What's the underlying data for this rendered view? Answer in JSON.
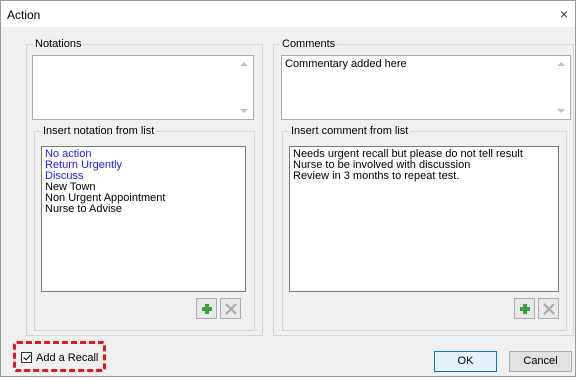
{
  "window": {
    "title": "Action",
    "close_glyph": "×"
  },
  "notations": {
    "group_label": "Notations",
    "value": "",
    "list_label": "Insert notation from list",
    "items": [
      {
        "text": "No action",
        "color": "#1a1aff"
      },
      {
        "text": "Return Urgently",
        "color": "#1a1aff"
      },
      {
        "text": "Discuss",
        "color": "#1a1aff"
      },
      {
        "text": "New Town",
        "color": "#000000"
      },
      {
        "text": "Non Urgent Appointment",
        "color": "#000000"
      },
      {
        "text": "Nurse to Advise",
        "color": "#000000"
      }
    ]
  },
  "comments": {
    "group_label": "Comments",
    "value": "Commentary added here",
    "list_label": "Insert comment from list",
    "items": [
      {
        "text": "Needs urgent recall but please do not tell result",
        "color": "#000000"
      },
      {
        "text": "Nurse to be involved with discussion",
        "color": "#000000"
      },
      {
        "text": "Review in 3 months to repeat test.",
        "color": "#000000"
      }
    ]
  },
  "footer": {
    "recall_label": "Add a Recall",
    "recall_checked": true,
    "ok_label": "OK",
    "cancel_label": "Cancel"
  },
  "colors": {
    "highlight": "#e8141e",
    "add_icon": "#3aa23a"
  }
}
